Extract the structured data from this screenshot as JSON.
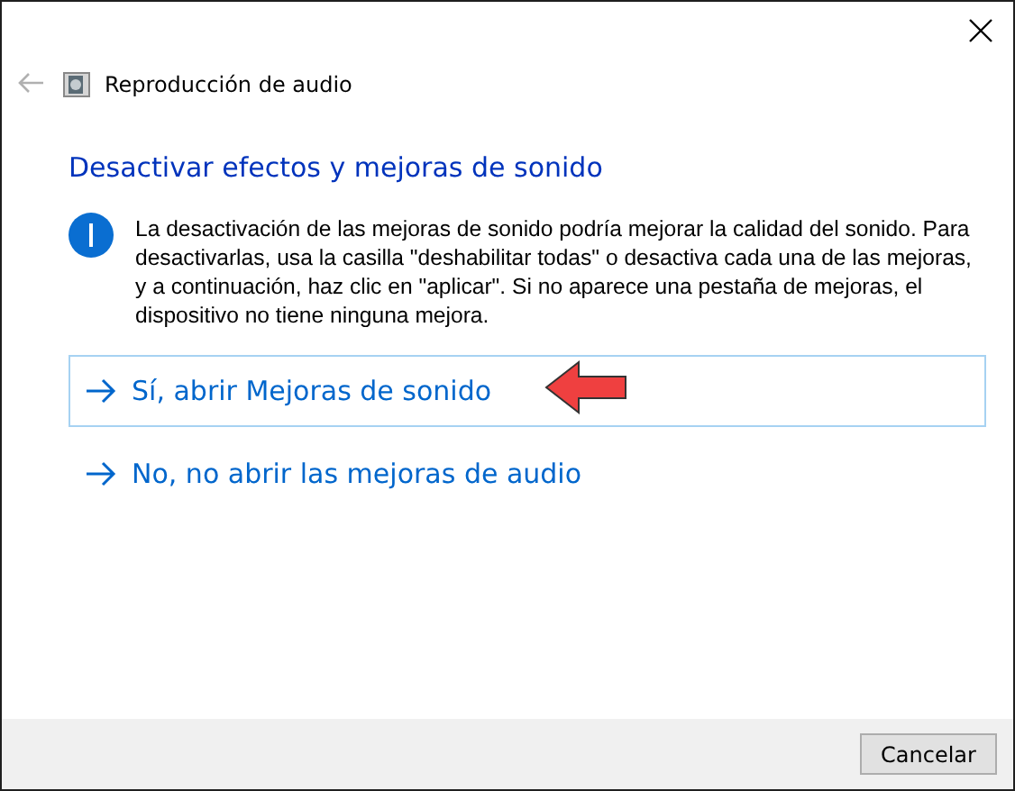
{
  "window": {
    "title": "Reproducción de audio",
    "back_disabled": true
  },
  "heading": "Desactivar efectos y mejoras de sonido",
  "info": "La desactivación de las mejoras de sonido podría mejorar la calidad del sonido. Para desactivarlas, usa la casilla \"deshabilitar todas\" o desactiva cada una de las mejoras, y a continuación, haz clic en \"aplicar\". Si no aparece una pestaña de mejoras, el dispositivo no tiene ninguna mejora.",
  "options": [
    {
      "label": "Sí, abrir Mejoras de sonido",
      "highlighted": true
    },
    {
      "label": "No, no abrir las mejoras de audio",
      "highlighted": false
    }
  ],
  "buttons": [
    "Cancelar"
  ]
}
